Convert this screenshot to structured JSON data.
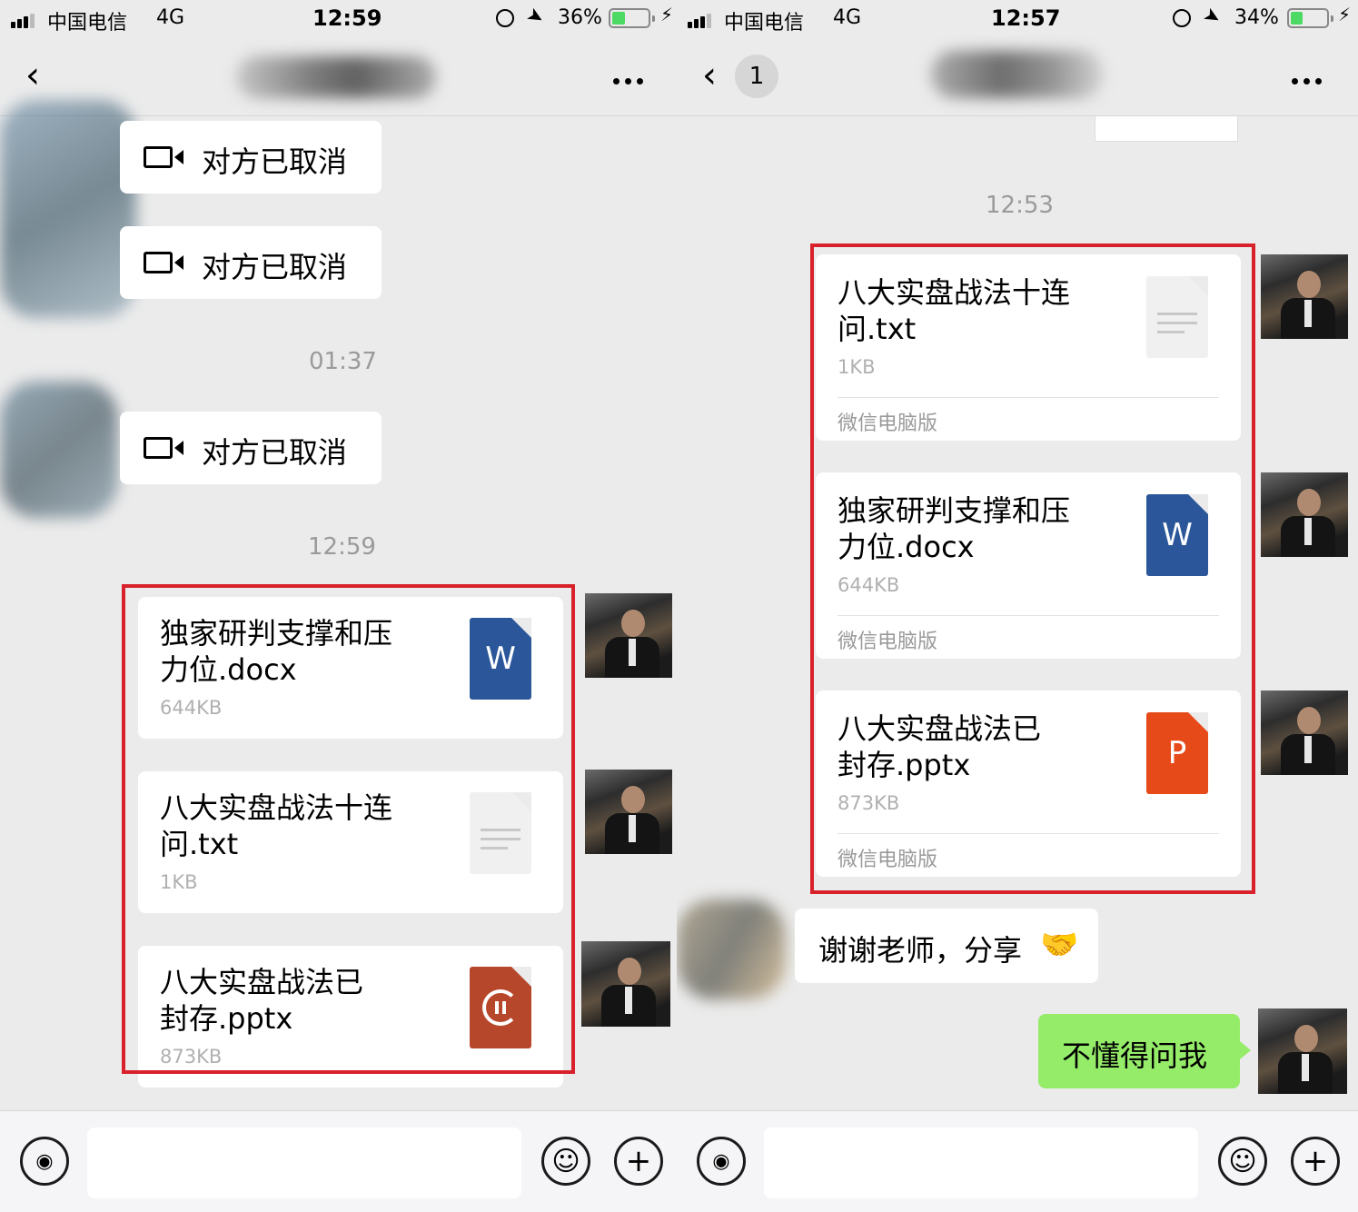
{
  "left": {
    "status": {
      "carrier": "中国电信",
      "network": "4G",
      "time": "12:59",
      "battery": "36%",
      "battery_level": 0.36
    },
    "calls": [
      {
        "text": "对方已取消"
      },
      {
        "text": "对方已取消"
      },
      {
        "text": "对方已取消"
      }
    ],
    "timestamps": [
      "01:37",
      "12:59"
    ],
    "files": [
      {
        "name_line1": "独家研判支撑和压",
        "name_line2": "力位.docx",
        "size": "644KB",
        "icon": "word-icon",
        "icon_letter": "W",
        "icon_color": "#2b579a"
      },
      {
        "name_line1": "八大实盘战法十连",
        "name_line2": "问.txt",
        "size": "1KB",
        "icon": "text-file-icon",
        "icon_letter": "",
        "icon_color": "#f0f0f0"
      },
      {
        "name_line1": "八大实盘战法已",
        "name_line2": "封存.pptx",
        "size": "873KB",
        "icon": "powerpoint-downloading-icon",
        "icon_letter": "",
        "icon_color": "#b7472a"
      }
    ]
  },
  "right": {
    "status": {
      "carrier": "中国电信",
      "network": "4G",
      "time": "12:57",
      "battery": "34%",
      "battery_level": 0.34
    },
    "unread_badge": "1",
    "timestamp": "12:53",
    "files": [
      {
        "name_line1": "八大实盘战法十连",
        "name_line2": "问.txt",
        "size": "1KB",
        "source": "微信电脑版",
        "icon": "text-file-icon",
        "icon_letter": "",
        "icon_color": "#f0f0f0"
      },
      {
        "name_line1": "独家研判支撑和压",
        "name_line2": "力位.docx",
        "size": "644KB",
        "source": "微信电脑版",
        "icon": "word-icon",
        "icon_letter": "W",
        "icon_color": "#2b579a"
      },
      {
        "name_line1": "八大实盘战法已",
        "name_line2": "封存.pptx",
        "size": "873KB",
        "source": "微信电脑版",
        "icon": "powerpoint-icon",
        "icon_letter": "P",
        "icon_color": "#e64a19"
      }
    ],
    "incoming_message": {
      "text": "谢谢老师，分享",
      "emoji": "🤝"
    },
    "outgoing_message": {
      "text": "不懂得问我"
    }
  },
  "colors": {
    "highlight_box": "#d9212c",
    "sent_bubble": "#95ec69",
    "chat_background": "#ebebeb"
  }
}
